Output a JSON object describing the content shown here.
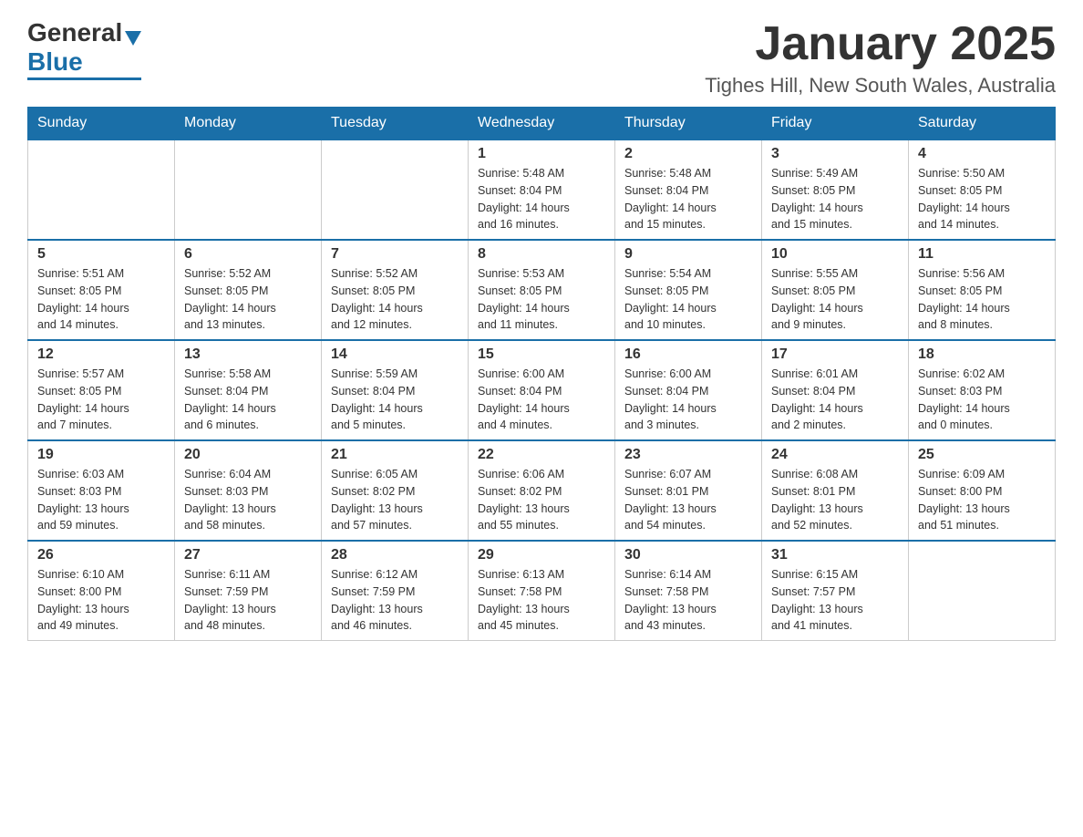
{
  "header": {
    "logo": {
      "general": "General",
      "blue": "Blue"
    },
    "title": "January 2025",
    "location": "Tighes Hill, New South Wales, Australia"
  },
  "calendar": {
    "days_of_week": [
      "Sunday",
      "Monday",
      "Tuesday",
      "Wednesday",
      "Thursday",
      "Friday",
      "Saturday"
    ],
    "weeks": [
      [
        {
          "day": "",
          "info": ""
        },
        {
          "day": "",
          "info": ""
        },
        {
          "day": "",
          "info": ""
        },
        {
          "day": "1",
          "info": "Sunrise: 5:48 AM\nSunset: 8:04 PM\nDaylight: 14 hours\nand 16 minutes."
        },
        {
          "day": "2",
          "info": "Sunrise: 5:48 AM\nSunset: 8:04 PM\nDaylight: 14 hours\nand 15 minutes."
        },
        {
          "day": "3",
          "info": "Sunrise: 5:49 AM\nSunset: 8:05 PM\nDaylight: 14 hours\nand 15 minutes."
        },
        {
          "day": "4",
          "info": "Sunrise: 5:50 AM\nSunset: 8:05 PM\nDaylight: 14 hours\nand 14 minutes."
        }
      ],
      [
        {
          "day": "5",
          "info": "Sunrise: 5:51 AM\nSunset: 8:05 PM\nDaylight: 14 hours\nand 14 minutes."
        },
        {
          "day": "6",
          "info": "Sunrise: 5:52 AM\nSunset: 8:05 PM\nDaylight: 14 hours\nand 13 minutes."
        },
        {
          "day": "7",
          "info": "Sunrise: 5:52 AM\nSunset: 8:05 PM\nDaylight: 14 hours\nand 12 minutes."
        },
        {
          "day": "8",
          "info": "Sunrise: 5:53 AM\nSunset: 8:05 PM\nDaylight: 14 hours\nand 11 minutes."
        },
        {
          "day": "9",
          "info": "Sunrise: 5:54 AM\nSunset: 8:05 PM\nDaylight: 14 hours\nand 10 minutes."
        },
        {
          "day": "10",
          "info": "Sunrise: 5:55 AM\nSunset: 8:05 PM\nDaylight: 14 hours\nand 9 minutes."
        },
        {
          "day": "11",
          "info": "Sunrise: 5:56 AM\nSunset: 8:05 PM\nDaylight: 14 hours\nand 8 minutes."
        }
      ],
      [
        {
          "day": "12",
          "info": "Sunrise: 5:57 AM\nSunset: 8:05 PM\nDaylight: 14 hours\nand 7 minutes."
        },
        {
          "day": "13",
          "info": "Sunrise: 5:58 AM\nSunset: 8:04 PM\nDaylight: 14 hours\nand 6 minutes."
        },
        {
          "day": "14",
          "info": "Sunrise: 5:59 AM\nSunset: 8:04 PM\nDaylight: 14 hours\nand 5 minutes."
        },
        {
          "day": "15",
          "info": "Sunrise: 6:00 AM\nSunset: 8:04 PM\nDaylight: 14 hours\nand 4 minutes."
        },
        {
          "day": "16",
          "info": "Sunrise: 6:00 AM\nSunset: 8:04 PM\nDaylight: 14 hours\nand 3 minutes."
        },
        {
          "day": "17",
          "info": "Sunrise: 6:01 AM\nSunset: 8:04 PM\nDaylight: 14 hours\nand 2 minutes."
        },
        {
          "day": "18",
          "info": "Sunrise: 6:02 AM\nSunset: 8:03 PM\nDaylight: 14 hours\nand 0 minutes."
        }
      ],
      [
        {
          "day": "19",
          "info": "Sunrise: 6:03 AM\nSunset: 8:03 PM\nDaylight: 13 hours\nand 59 minutes."
        },
        {
          "day": "20",
          "info": "Sunrise: 6:04 AM\nSunset: 8:03 PM\nDaylight: 13 hours\nand 58 minutes."
        },
        {
          "day": "21",
          "info": "Sunrise: 6:05 AM\nSunset: 8:02 PM\nDaylight: 13 hours\nand 57 minutes."
        },
        {
          "day": "22",
          "info": "Sunrise: 6:06 AM\nSunset: 8:02 PM\nDaylight: 13 hours\nand 55 minutes."
        },
        {
          "day": "23",
          "info": "Sunrise: 6:07 AM\nSunset: 8:01 PM\nDaylight: 13 hours\nand 54 minutes."
        },
        {
          "day": "24",
          "info": "Sunrise: 6:08 AM\nSunset: 8:01 PM\nDaylight: 13 hours\nand 52 minutes."
        },
        {
          "day": "25",
          "info": "Sunrise: 6:09 AM\nSunset: 8:00 PM\nDaylight: 13 hours\nand 51 minutes."
        }
      ],
      [
        {
          "day": "26",
          "info": "Sunrise: 6:10 AM\nSunset: 8:00 PM\nDaylight: 13 hours\nand 49 minutes."
        },
        {
          "day": "27",
          "info": "Sunrise: 6:11 AM\nSunset: 7:59 PM\nDaylight: 13 hours\nand 48 minutes."
        },
        {
          "day": "28",
          "info": "Sunrise: 6:12 AM\nSunset: 7:59 PM\nDaylight: 13 hours\nand 46 minutes."
        },
        {
          "day": "29",
          "info": "Sunrise: 6:13 AM\nSunset: 7:58 PM\nDaylight: 13 hours\nand 45 minutes."
        },
        {
          "day": "30",
          "info": "Sunrise: 6:14 AM\nSunset: 7:58 PM\nDaylight: 13 hours\nand 43 minutes."
        },
        {
          "day": "31",
          "info": "Sunrise: 6:15 AM\nSunset: 7:57 PM\nDaylight: 13 hours\nand 41 minutes."
        },
        {
          "day": "",
          "info": ""
        }
      ]
    ]
  }
}
